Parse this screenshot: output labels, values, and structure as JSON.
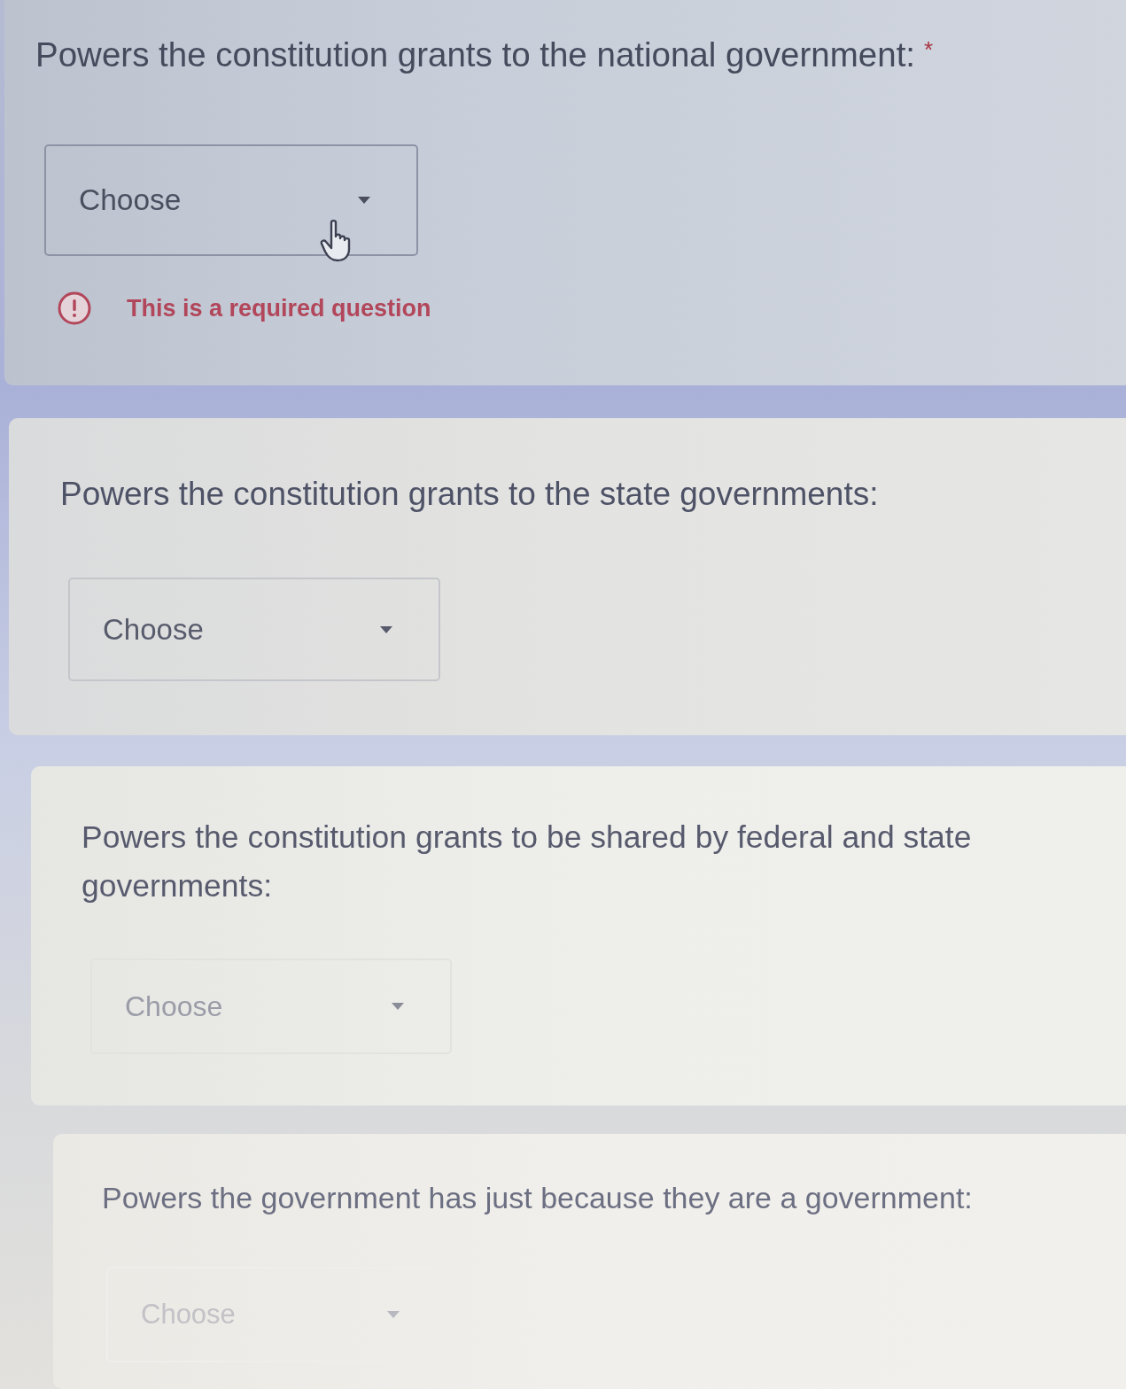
{
  "questions": [
    {
      "title": "Powers the constitution grants to the national government:",
      "required_mark": "*",
      "dropdown": {
        "placeholder": "Choose",
        "hovered": true
      },
      "error": "This is a required question"
    },
    {
      "title": "Powers the constitution grants to the state governments:",
      "dropdown": {
        "placeholder": "Choose",
        "hovered": false
      }
    },
    {
      "title": "Powers the constitution grants to be shared by federal and state governments:",
      "dropdown": {
        "placeholder": "Choose",
        "hovered": false
      }
    },
    {
      "title": "Powers the government has just because they are a government:",
      "dropdown": {
        "placeholder": "Choose",
        "hovered": false
      }
    }
  ]
}
